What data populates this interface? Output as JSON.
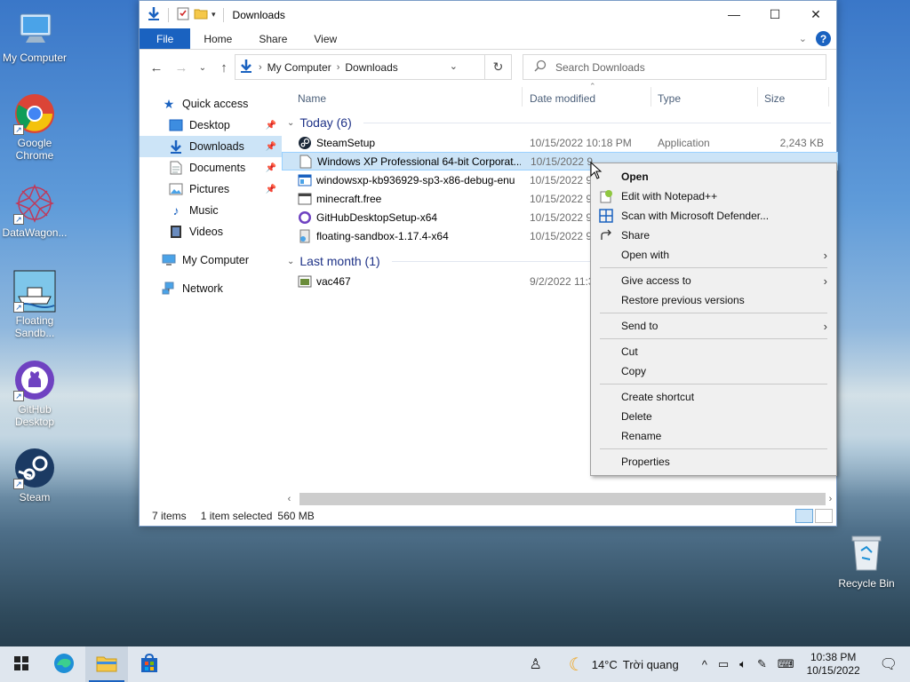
{
  "desktop": {
    "icons": [
      {
        "label": "My Computer"
      },
      {
        "label": "Google Chrome"
      },
      {
        "label": "DataWagon..."
      },
      {
        "label": "Floating Sandb..."
      },
      {
        "label": "GitHub Desktop"
      },
      {
        "label": "Steam"
      }
    ],
    "recycle_bin": "Recycle Bin"
  },
  "window": {
    "title": "Downloads",
    "ribbon_tabs": [
      "File",
      "Home",
      "Share",
      "View"
    ],
    "help": "?",
    "address": {
      "crumbs": [
        "My Computer",
        "Downloads"
      ]
    },
    "search_placeholder": "Search Downloads"
  },
  "navpane": {
    "items": [
      {
        "label": "Quick access",
        "pinned": false
      },
      {
        "label": "Desktop",
        "pinned": true
      },
      {
        "label": "Downloads",
        "pinned": true
      },
      {
        "label": "Documents",
        "pinned": true
      },
      {
        "label": "Pictures",
        "pinned": true
      },
      {
        "label": "Music",
        "pinned": false
      },
      {
        "label": "Videos",
        "pinned": false
      },
      {
        "label": "My Computer",
        "pinned": false
      },
      {
        "label": "Network",
        "pinned": false
      }
    ]
  },
  "filelist": {
    "columns": [
      "Name",
      "Date modified",
      "Type",
      "Size"
    ],
    "groups": [
      {
        "label": "Today (6)"
      },
      {
        "label": "Last month (1)"
      }
    ],
    "rows": [
      {
        "name": "SteamSetup",
        "date": "10/15/2022 10:18 PM",
        "type": "Application",
        "size": "2,243 KB"
      },
      {
        "name": "Windows XP Professional 64-bit Corporat...",
        "date": "10/15/2022 9",
        "type": "",
        "size": ""
      },
      {
        "name": "windowsxp-kb936929-sp3-x86-debug-enu",
        "date": "10/15/2022 9",
        "type": "",
        "size": ""
      },
      {
        "name": "minecraft.free",
        "date": "10/15/2022 9",
        "type": "",
        "size": ""
      },
      {
        "name": "GitHubDesktopSetup-x64",
        "date": "10/15/2022 9",
        "type": "",
        "size": ""
      },
      {
        "name": "floating-sandbox-1.17.4-x64",
        "date": "10/15/2022 9",
        "type": "",
        "size": ""
      },
      {
        "name": "vac467",
        "date": "9/2/2022 11:3",
        "type": "",
        "size": ""
      }
    ]
  },
  "statusbar": {
    "count": "7 items",
    "selected": "1 item selected",
    "size": "560 MB"
  },
  "context_menu": {
    "items": [
      "Open",
      "Edit with Notepad++",
      "Scan with Microsoft Defender...",
      "Share",
      "Open with",
      "Give access to",
      "Restore previous versions",
      "Send to",
      "Cut",
      "Copy",
      "Create shortcut",
      "Delete",
      "Rename",
      "Properties"
    ]
  },
  "taskbar": {
    "weather": {
      "temp": "14°C",
      "desc": "Trời quang"
    },
    "clock": {
      "time": "10:38 PM",
      "date": "10/15/2022"
    }
  }
}
